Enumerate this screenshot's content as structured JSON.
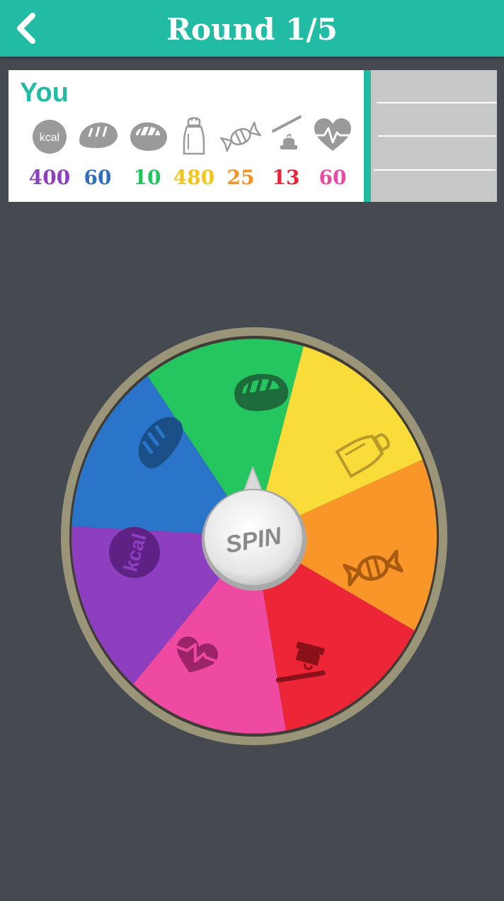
{
  "header": {
    "title": "Round 1/5",
    "back_icon": "chevron-left-icon",
    "background": "#22bba3"
  },
  "player": {
    "name": "You",
    "stats": [
      {
        "key": "kcal",
        "icon": "kcal-icon",
        "icon_text": "kcal",
        "value": "400",
        "color": "#8e3fbf"
      },
      {
        "key": "carbs",
        "icon": "bread-icon",
        "value": "60",
        "color": "#2f6fc0"
      },
      {
        "key": "protein",
        "icon": "steak-icon",
        "value": "10",
        "color": "#23c45e"
      },
      {
        "key": "salt",
        "icon": "salt-shaker-icon",
        "value": "480",
        "color": "#f2c51a"
      },
      {
        "key": "sugar",
        "icon": "candy-icon",
        "value": "25",
        "color": "#f39325"
      },
      {
        "key": "fat",
        "icon": "butter-knife-icon",
        "value": "13",
        "color": "#e8263a"
      },
      {
        "key": "health",
        "icon": "heartbeat-icon",
        "value": "60",
        "color": "#ec4aa4"
      }
    ]
  },
  "wheel": {
    "spin_label": "SPIN",
    "segments": [
      {
        "name": "protein",
        "icon": "steak-icon",
        "color": "#25c660"
      },
      {
        "name": "salt",
        "icon": "salt-shaker-icon",
        "color": "#f9dc3a"
      },
      {
        "name": "sugar",
        "icon": "candy-icon",
        "color": "#f8962a"
      },
      {
        "name": "fat",
        "icon": "butter-knife-icon",
        "color": "#ed2637"
      },
      {
        "name": "health",
        "icon": "heartbeat-icon",
        "color": "#ee4aa2"
      },
      {
        "name": "kcal",
        "icon": "kcal-icon",
        "icon_text": "kcal",
        "color": "#8d3fbf"
      },
      {
        "name": "carbs",
        "icon": "bread-icon",
        "color": "#2a74c9"
      }
    ],
    "rim_color": "#9a9478"
  },
  "colors": {
    "background": "#454a51",
    "opponent_panel": "#c8c8c8"
  }
}
